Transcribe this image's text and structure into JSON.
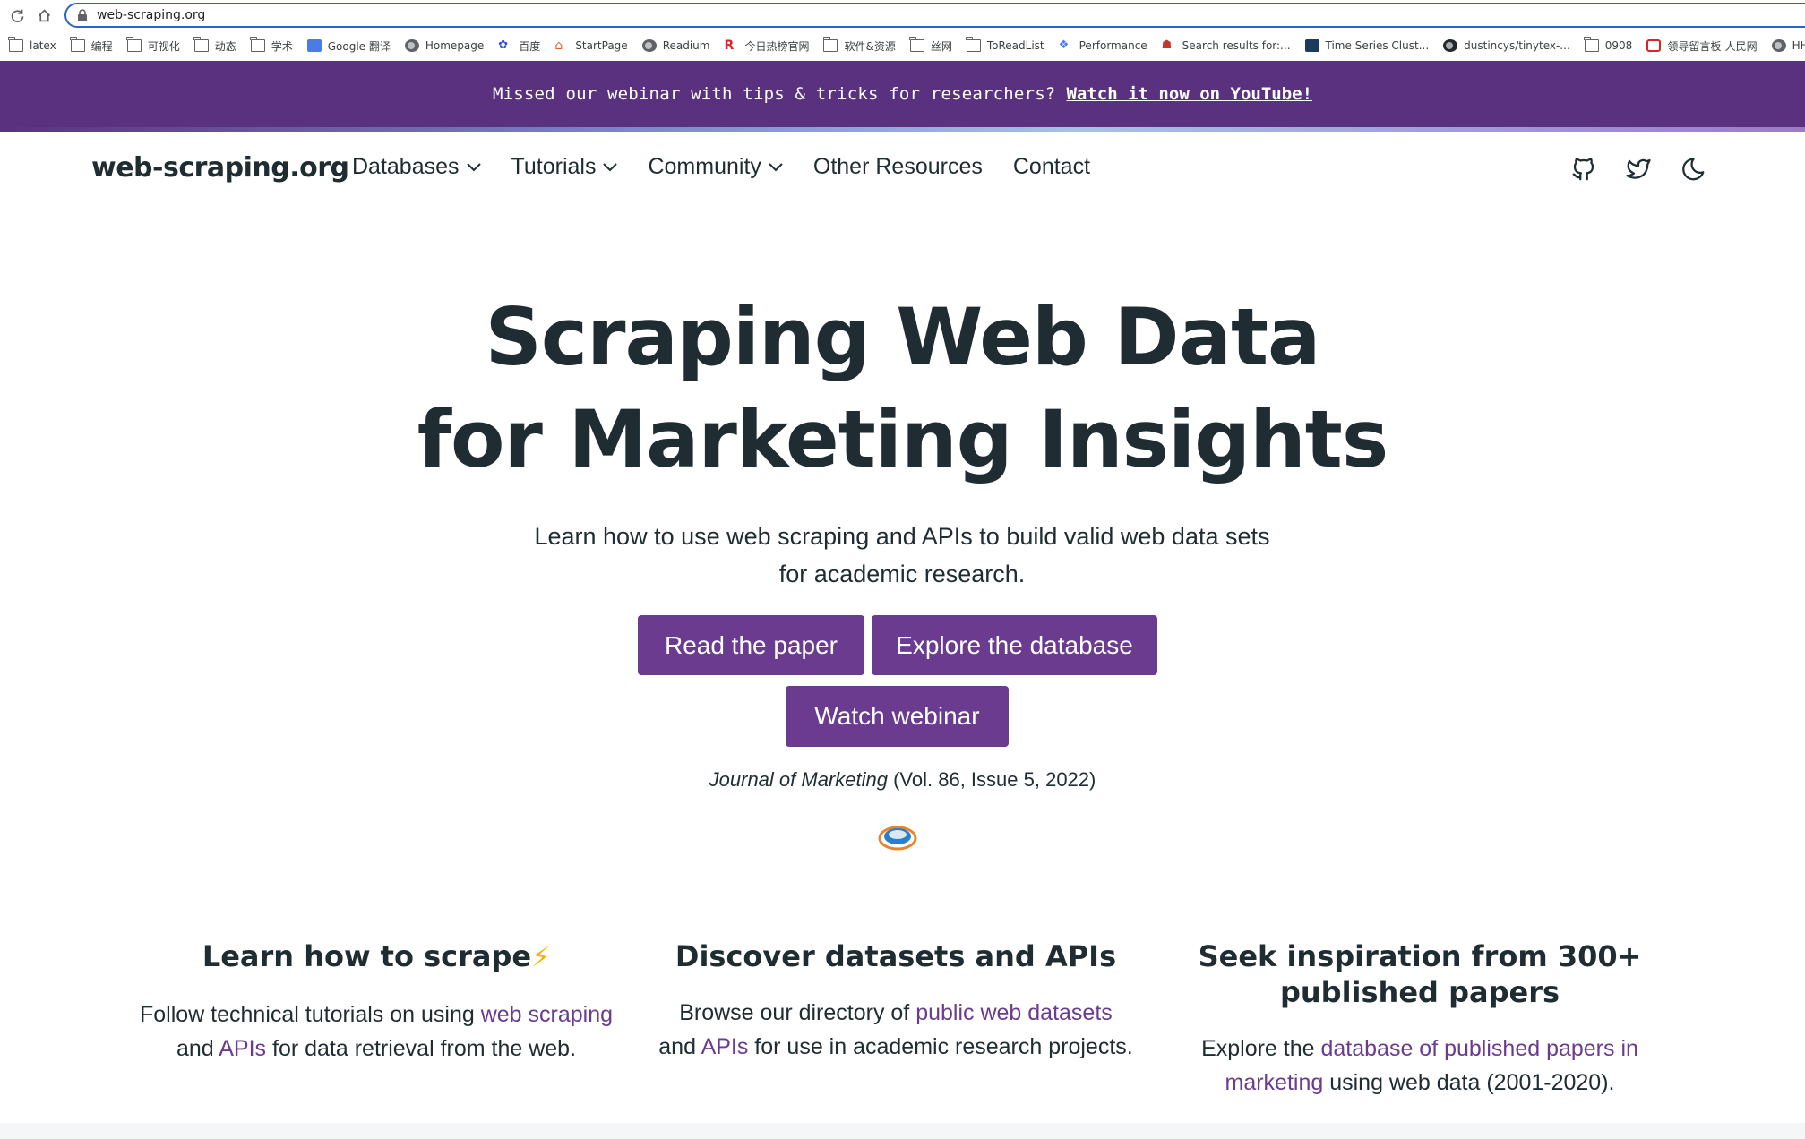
{
  "browser": {
    "url": "web-scraping.org",
    "bookmarks": [
      {
        "label": "latex",
        "icon": "folder-icon"
      },
      {
        "label": "编程",
        "icon": "folder-icon"
      },
      {
        "label": "可视化",
        "icon": "folder-icon"
      },
      {
        "label": "动态",
        "icon": "folder-icon"
      },
      {
        "label": "学术",
        "icon": "folder-icon"
      },
      {
        "label": "Google 翻译",
        "icon": "google-translate-icon"
      },
      {
        "label": "Homepage",
        "icon": "globe-icon"
      },
      {
        "label": "百度",
        "icon": "baidu-icon"
      },
      {
        "label": "StartPage",
        "icon": "home-icon"
      },
      {
        "label": "Readium",
        "icon": "globe-icon"
      },
      {
        "label": "今日热榜官网",
        "icon": "r-icon"
      },
      {
        "label": "软件&资源",
        "icon": "folder-icon"
      },
      {
        "label": "丝网",
        "icon": "folder-icon"
      },
      {
        "label": "ToReadList",
        "icon": "folder-icon"
      },
      {
        "label": "Performance",
        "icon": "performance-icon"
      },
      {
        "label": "Search results for:...",
        "icon": "search-results-icon"
      },
      {
        "label": "Time Series Clust...",
        "icon": "tds-icon"
      },
      {
        "label": "dustincys/tinytex-...",
        "icon": "github-icon"
      },
      {
        "label": "0908",
        "icon": "folder-icon"
      },
      {
        "label": "领导留言板-人民网",
        "icon": "people-icon"
      },
      {
        "label": "HHKE",
        "icon": "globe-icon"
      }
    ]
  },
  "announcement": {
    "text": "Missed our webinar with tips & tricks for researchers?",
    "link": "Watch it now on YouTube!"
  },
  "nav": {
    "logo": "web-scraping.org",
    "items": [
      {
        "label": "Databases",
        "dropdown": true
      },
      {
        "label": "Tutorials",
        "dropdown": true
      },
      {
        "label": "Community",
        "dropdown": true
      },
      {
        "label": "Other Resources",
        "dropdown": false
      },
      {
        "label": "Contact",
        "dropdown": false
      }
    ],
    "icons": [
      "github-icon",
      "twitter-icon",
      "dark-mode-icon"
    ]
  },
  "hero": {
    "title_line1": "Scraping Web Data",
    "title_line2": "for Marketing Insights",
    "subtitle_line1": "Learn how to use web scraping and APIs to build valid web data sets",
    "subtitle_line2": "for academic research.",
    "buttons": {
      "paper": "Read the paper",
      "database": "Explore the database",
      "webinar": "Watch webinar"
    },
    "citation_journal": "Journal of Marketing",
    "citation_details": "(Vol. 86, Issue 5, 2022)"
  },
  "features": [
    {
      "title": "Learn how to scrape",
      "title_emoji": "⚡",
      "text_pre": "Follow technical tutorials on using ",
      "link1": "web scraping",
      "text_mid": " and ",
      "link2": "APIs",
      "text_post": " for data retrieval from the web."
    },
    {
      "title": "Discover datasets and APIs",
      "text_pre": "Browse our directory of ",
      "link1": "public web datasets",
      "text_mid": " and ",
      "link2": "APIs",
      "text_post": " for use in academic research projects."
    },
    {
      "title_line1": "Seek inspiration from 300+",
      "title_line2": "published papers",
      "text_pre": "Explore the ",
      "link1": "database of published papers in marketing",
      "text_post": " using web data (2001-2020)."
    }
  ],
  "colors": {
    "brand_purple": "#5a317f",
    "button_purple": "#6a3b8f",
    "text_dark": "#1f2d33"
  }
}
